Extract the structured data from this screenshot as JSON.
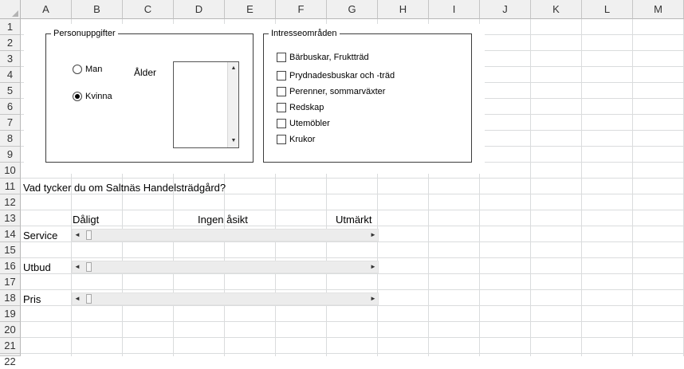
{
  "columns": [
    "A",
    "B",
    "C",
    "D",
    "E",
    "F",
    "G",
    "H",
    "I",
    "J",
    "K",
    "L",
    "M"
  ],
  "rows": [
    "1",
    "2",
    "3",
    "4",
    "5",
    "6",
    "7",
    "8",
    "9",
    "10",
    "11",
    "12",
    "13",
    "14",
    "15",
    "16",
    "17",
    "18",
    "19",
    "20",
    "21",
    "22"
  ],
  "personal_group": {
    "label": "Personuppgifter",
    "gender_options": [
      {
        "label": "Man",
        "selected": false
      },
      {
        "label": "Kvinna",
        "selected": true
      }
    ],
    "age_label": "Ålder"
  },
  "interest_group": {
    "label": "Intresseområden",
    "items": [
      {
        "label": "Bärbuskar, Fruktträd",
        "checked": false
      },
      {
        "label": "Prydnadesbuskar och -träd",
        "checked": false
      },
      {
        "label": "Perenner, sommarväxter",
        "checked": false
      },
      {
        "label": "Redskap",
        "checked": false
      },
      {
        "label": "Utemöbler",
        "checked": false
      },
      {
        "label": "Krukor",
        "checked": false
      }
    ]
  },
  "survey": {
    "question": "Vad tycker du om Saltnäs Handelsträdgård?",
    "scale_low": "Dåligt",
    "scale_mid": "Ingen åsikt",
    "scale_high": "Utmärkt",
    "ratings": [
      {
        "label": "Service",
        "value": 0
      },
      {
        "label": "Utbud",
        "value": 0
      },
      {
        "label": "Pris",
        "value": 0
      }
    ]
  },
  "scroll_arrows": {
    "left": "◄",
    "right": "►",
    "up": "▲",
    "down": "▼"
  }
}
